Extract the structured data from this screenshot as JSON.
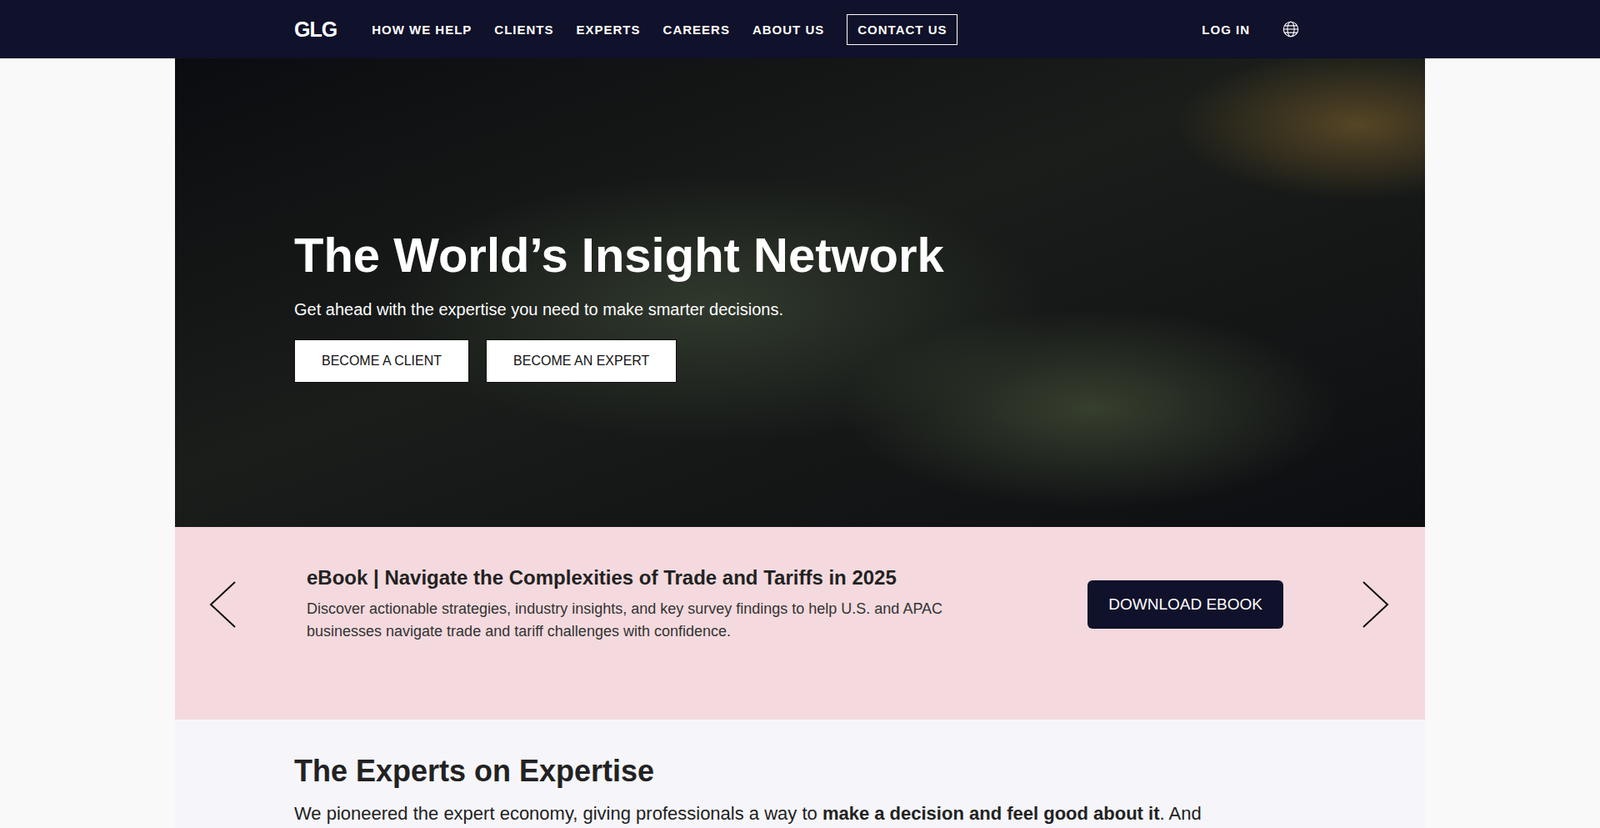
{
  "nav": {
    "logo": "GLG",
    "items": [
      "HOW WE HELP",
      "CLIENTS",
      "EXPERTS",
      "CAREERS",
      "ABOUT US"
    ],
    "contact": "CONTACT US",
    "login": "LOG IN"
  },
  "hero": {
    "title": "The World’s Insight Network",
    "subtitle": "Get ahead with the expertise you need to make smarter decisions.",
    "buttons": [
      "BECOME A CLIENT",
      "BECOME AN EXPERT"
    ]
  },
  "banner": {
    "title": "eBook | Navigate the Complexities of Trade and Tariffs in 2025",
    "description": "Discover actionable strategies, industry insights, and key survey findings to help U.S. and APAC businesses navigate trade and tariff challenges with confidence.",
    "button": "DOWNLOAD EBOOK"
  },
  "section": {
    "title": "The Experts on Expertise",
    "intro": [
      {
        "text": "We pioneered the expert economy, giving professionals a way to ",
        "bold": false
      },
      {
        "text": "make a decision and feel good about it",
        "bold": true
      },
      {
        "text": ". And",
        "bold": false
      }
    ]
  }
}
